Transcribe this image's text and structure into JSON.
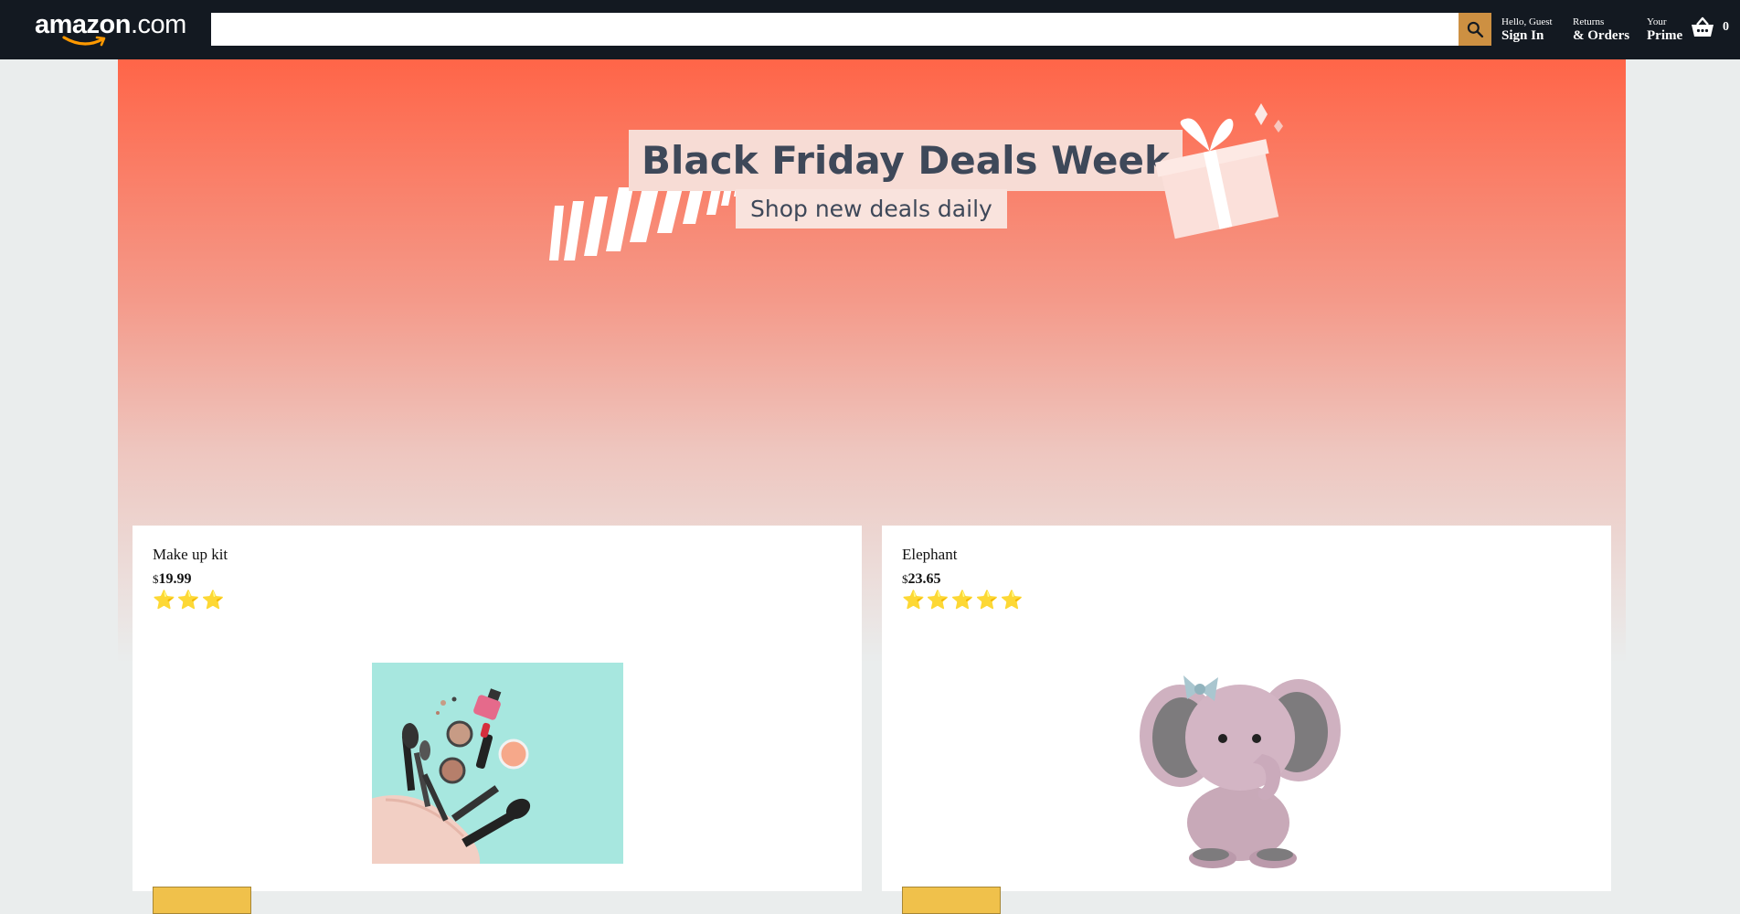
{
  "header": {
    "logo": {
      "brand": "amazon",
      "suffix": ".com"
    },
    "search": {
      "value": "",
      "placeholder": ""
    },
    "nav": [
      {
        "line1": "Hello, Guest",
        "line2": "Sign In"
      },
      {
        "line1": "Returns",
        "line2": "& Orders"
      },
      {
        "line1": "Your",
        "line2": "Prime"
      }
    ],
    "basket": {
      "count": "0",
      "icon": "basket-icon"
    }
  },
  "hero": {
    "title": "Black Friday Deals Week",
    "subtitle": "Shop new deals daily",
    "icon": "gift-icon"
  },
  "products": [
    {
      "title": "Make up kit",
      "currency": "$",
      "price": "19.99",
      "rating": 3,
      "stars": [
        "⭐",
        "⭐",
        "⭐"
      ],
      "image": "makeup-kit-image"
    },
    {
      "title": "Elephant",
      "currency": "$",
      "price": "23.65",
      "rating": 5,
      "stars": [
        "⭐",
        "⭐",
        "⭐",
        "⭐",
        "⭐"
      ],
      "image": "plush-elephant-image"
    }
  ],
  "colors": {
    "header_bg": "#131921",
    "search_button": "#cd9042",
    "hero_top": "#ff6548",
    "page_bg": "#eaeded",
    "star": "#f6c31b",
    "add_button": "#f0c14b"
  }
}
